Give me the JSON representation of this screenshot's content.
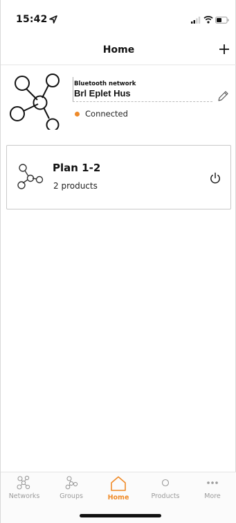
{
  "status_bar": {
    "time": "15:42"
  },
  "nav": {
    "title": "Home",
    "add_icon": "plus-icon"
  },
  "network": {
    "type_label": "Bluetooth network",
    "name": "Brl Eplet Hus",
    "status": "Connected",
    "status_color": "#ee8a2a"
  },
  "group": {
    "name": "Plan 1-2",
    "count": "2 products"
  },
  "tabs": [
    {
      "label": "Networks",
      "icon": "network-icon",
      "active": false
    },
    {
      "label": "Groups",
      "icon": "groups-icon",
      "active": false
    },
    {
      "label": "Home",
      "icon": "home-icon",
      "active": true
    },
    {
      "label": "Products",
      "icon": "product-icon",
      "active": false
    },
    {
      "label": "More",
      "icon": "more-icon",
      "active": false
    }
  ],
  "colors": {
    "accent": "#f08a26",
    "inactive": "#9a9a9a"
  }
}
